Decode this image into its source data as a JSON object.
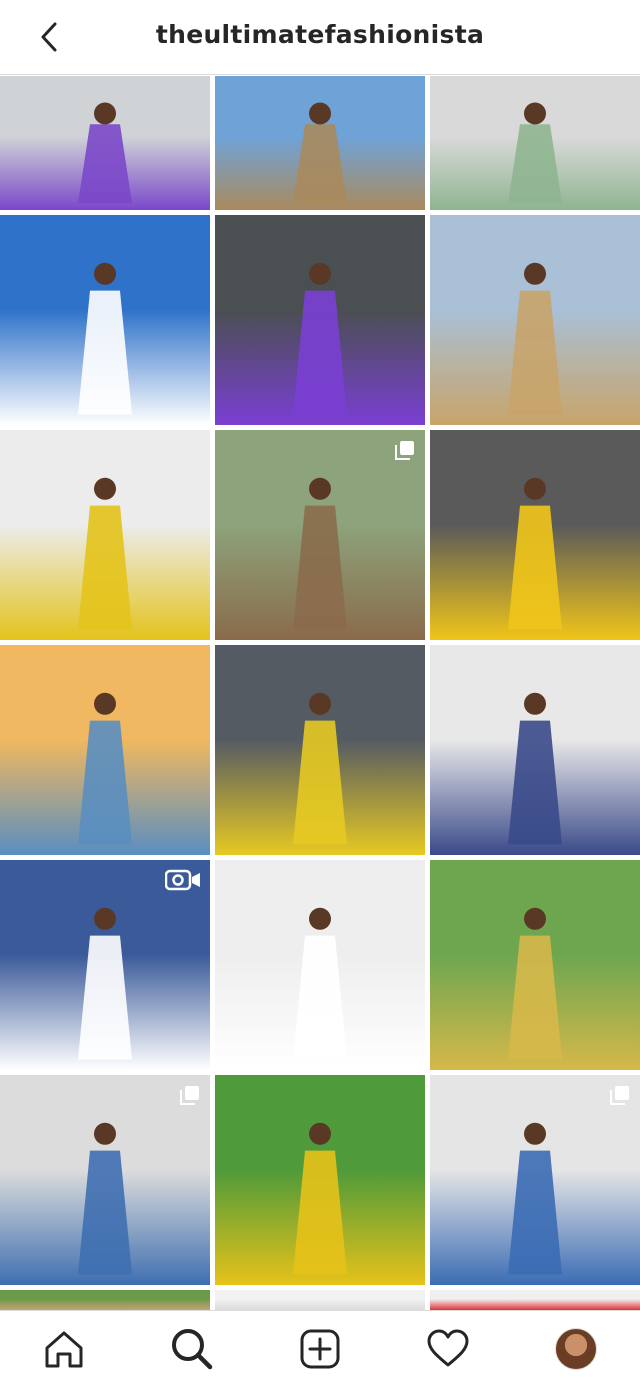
{
  "header": {
    "title": "theultimatefashionista",
    "back_icon": "chevron-left-icon"
  },
  "posts": [
    {
      "row": 0,
      "col": 0,
      "desc": "purple-duster-coat",
      "colors": [
        "#cfd3d6",
        "#7b48c9"
      ],
      "badge": null
    },
    {
      "row": 0,
      "col": 1,
      "desc": "palm-desert",
      "colors": [
        "#6fa3d8",
        "#a98a5d"
      ],
      "badge": null
    },
    {
      "row": 0,
      "col": 2,
      "desc": "green-dress-heels",
      "colors": [
        "#d9d9d9",
        "#8fb590"
      ],
      "badge": null
    },
    {
      "row": 1,
      "col": 0,
      "desc": "palm-street",
      "colors": [
        "#2f72c9",
        "#ffffff"
      ],
      "badge": null
    },
    {
      "row": 1,
      "col": 1,
      "desc": "purple-doorway",
      "colors": [
        "#4a4f52",
        "#7a3fd3"
      ],
      "badge": null
    },
    {
      "row": 1,
      "col": 2,
      "desc": "desert-hills",
      "colors": [
        "#a9c0d6",
        "#c8a46a"
      ],
      "badge": null
    },
    {
      "row": 2,
      "col": 0,
      "desc": "yellow-hat-stripes",
      "colors": [
        "#ececec",
        "#e3c31b"
      ],
      "badge": null
    },
    {
      "row": 2,
      "col": 1,
      "desc": "leopard-dress",
      "colors": [
        "#8da37b",
        "#8a6b4b"
      ],
      "badge": "carousel-icon"
    },
    {
      "row": 2,
      "col": 2,
      "desc": "yellow-hat-portrait",
      "colors": [
        "#5a5a5a",
        "#f0c519"
      ],
      "badge": null
    },
    {
      "row": 3,
      "col": 0,
      "desc": "beach-sunset",
      "colors": [
        "#f0b860",
        "#5a8ec0"
      ],
      "badge": null
    },
    {
      "row": 3,
      "col": 1,
      "desc": "yellow-hat-striped-pants",
      "colors": [
        "#555b63",
        "#e6c922"
      ],
      "badge": null
    },
    {
      "row": 3,
      "col": 2,
      "desc": "white-sweater-boots",
      "colors": [
        "#e8e8e8",
        "#3a4a8a"
      ],
      "badge": null
    },
    {
      "row": 4,
      "col": 0,
      "desc": "mural-stripes",
      "colors": [
        "#3b5a9a",
        "#ffffff"
      ],
      "badge": "video-icon"
    },
    {
      "row": 4,
      "col": 1,
      "desc": "white-shirt-hat",
      "colors": [
        "#eeeeee",
        "#ffffff"
      ],
      "badge": null
    },
    {
      "row": 4,
      "col": 2,
      "desc": "yellow-dress-path",
      "colors": [
        "#6ea650",
        "#d6b84a"
      ],
      "badge": null
    },
    {
      "row": 5,
      "col": 0,
      "desc": "flare-jeans-cafe",
      "colors": [
        "#dcdcdc",
        "#3f6fb0"
      ],
      "badge": "carousel-icon"
    },
    {
      "row": 5,
      "col": 1,
      "desc": "yellow-dress-grass",
      "colors": [
        "#4f9a3a",
        "#e6c21a"
      ],
      "badge": null
    },
    {
      "row": 5,
      "col": 2,
      "desc": "jeans-checkered-bag",
      "colors": [
        "#e5e5e5",
        "#3b6cb4"
      ],
      "badge": "carousel-icon"
    },
    {
      "row": 6,
      "col": 0,
      "desc": "partial-row",
      "colors": [
        "#6a9a4a",
        "#c8a070"
      ],
      "badge": null
    },
    {
      "row": 6,
      "col": 1,
      "desc": "partial-row",
      "colors": [
        "#f2f2f2",
        "#dadada"
      ],
      "badge": null
    },
    {
      "row": 6,
      "col": 2,
      "desc": "partial-row",
      "colors": [
        "#f0f0f0",
        "#e23232"
      ],
      "badge": null
    }
  ],
  "tabbar": {
    "items": [
      "home-icon",
      "search-icon",
      "new-post-icon",
      "activity-heart-icon",
      "profile-avatar"
    ]
  }
}
